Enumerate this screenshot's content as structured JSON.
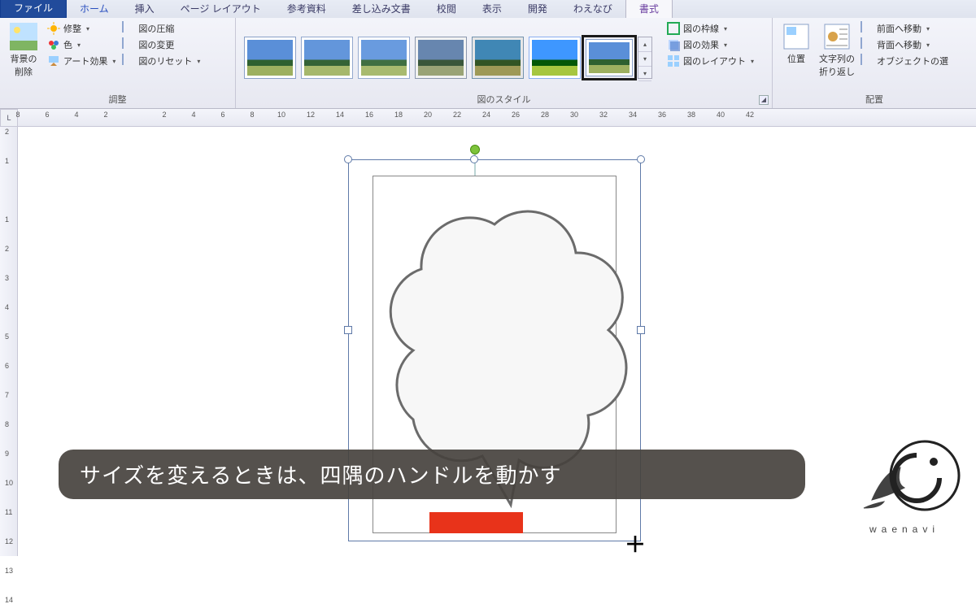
{
  "tabs": {
    "file": "ファイル",
    "items": [
      "ホーム",
      "挿入",
      "ページ レイアウト",
      "参考資料",
      "差し込み文書",
      "校閲",
      "表示",
      "開発",
      "わえなび"
    ],
    "active": "書式"
  },
  "ribbon": {
    "adjust": {
      "remove_bg": "背景の\n削除",
      "corrections": "修整",
      "color": "色",
      "artistic": "アート効果",
      "compress": "図の圧縮",
      "change": "図の変更",
      "reset": "図のリセット",
      "label": "調整"
    },
    "styles": {
      "border": "図の枠線",
      "effects": "図の効果",
      "layout": "図のレイアウト",
      "label": "図のスタイル"
    },
    "arrange": {
      "position": "位置",
      "wrap": "文字列の\n折り返し",
      "front": "前面へ移動",
      "back": "背面へ移動",
      "objsel": "オブジェクトの選",
      "label": "配置"
    }
  },
  "ruler": {
    "corner": "L",
    "h": [
      "8",
      "6",
      "4",
      "2",
      "",
      "2",
      "4",
      "6",
      "8",
      "10",
      "12",
      "14",
      "16",
      "18",
      "20",
      "22",
      "24",
      "26",
      "28",
      "30",
      "32",
      "34",
      "36",
      "38",
      "40",
      "42"
    ],
    "v": [
      "2",
      "1",
      "",
      "1",
      "2",
      "3",
      "4",
      "5",
      "6",
      "7",
      "8",
      "9",
      "10",
      "11",
      "12",
      "13",
      "14"
    ]
  },
  "caption": "サイズを変えるときは、四隅のハンドルを動かす",
  "brand": "waenavi"
}
